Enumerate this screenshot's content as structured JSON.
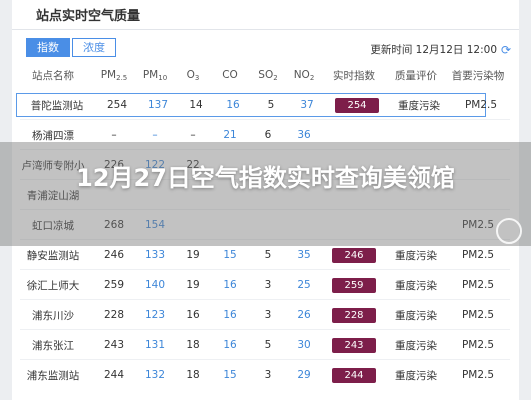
{
  "header": {
    "title": "站点实时空气质量"
  },
  "toolbar": {
    "tabs": [
      {
        "label": "指数",
        "active": true
      },
      {
        "label": "浓度",
        "active": false
      }
    ],
    "update_label": "更新时间 12月12日 12:00"
  },
  "table": {
    "columns": [
      "站点名称",
      "PM2.5",
      "PM10",
      "O3",
      "CO",
      "SO2",
      "NO2",
      "实时指数",
      "质量评价",
      "首要污染物"
    ],
    "rows": [
      {
        "name": "普陀监测站",
        "pm25": "254",
        "pm10": "137",
        "o3": "14",
        "co": "16",
        "so2": "5",
        "no2": "37",
        "aqi": "254",
        "level": "重度污染",
        "primary": "PM2.5",
        "selected": true
      },
      {
        "name": "杨浦四漂",
        "pm25": "–",
        "pm10": "–",
        "o3": "–",
        "co": "21",
        "so2": "6",
        "no2": "36",
        "aqi": "",
        "level": "",
        "primary": ""
      },
      {
        "name": "卢湾师专附小",
        "pm25": "226",
        "pm10": "122",
        "o3": "22",
        "co": "",
        "so2": "",
        "no2": "",
        "aqi": "",
        "level": "",
        "primary": ""
      },
      {
        "name": "青浦淀山湖",
        "pm25": "",
        "pm10": "",
        "o3": "",
        "co": "",
        "so2": "",
        "no2": "",
        "aqi": "",
        "level": "",
        "primary": ""
      },
      {
        "name": "虹口凉城",
        "pm25": "268",
        "pm10": "154",
        "o3": "",
        "co": "",
        "so2": "",
        "no2": "",
        "aqi": "",
        "level": "",
        "primary": "PM2.5"
      },
      {
        "name": "静安监测站",
        "pm25": "246",
        "pm10": "133",
        "o3": "19",
        "co": "15",
        "so2": "5",
        "no2": "35",
        "aqi": "246",
        "level": "重度污染",
        "primary": "PM2.5"
      },
      {
        "name": "徐汇上师大",
        "pm25": "259",
        "pm10": "140",
        "o3": "19",
        "co": "16",
        "so2": "3",
        "no2": "25",
        "aqi": "259",
        "level": "重度污染",
        "primary": "PM2.5"
      },
      {
        "name": "浦东川沙",
        "pm25": "228",
        "pm10": "123",
        "o3": "16",
        "co": "16",
        "so2": "3",
        "no2": "26",
        "aqi": "228",
        "level": "重度污染",
        "primary": "PM2.5"
      },
      {
        "name": "浦东张江",
        "pm25": "243",
        "pm10": "131",
        "o3": "18",
        "co": "16",
        "so2": "5",
        "no2": "30",
        "aqi": "243",
        "level": "重度污染",
        "primary": "PM2.5"
      },
      {
        "name": "浦东监测站",
        "pm25": "244",
        "pm10": "132",
        "o3": "18",
        "co": "15",
        "so2": "3",
        "no2": "29",
        "aqi": "244",
        "level": "重度污染",
        "primary": "PM2.5"
      }
    ]
  },
  "overlay": {
    "headline": "12月27日空气指数实时查询美领馆"
  },
  "colors": {
    "accent": "#4a8ee6",
    "aqi_badge": "#7d1e4a",
    "value_blue": "#3d86d8"
  },
  "icons": [
    "refresh-icon",
    "globe-icon"
  ]
}
